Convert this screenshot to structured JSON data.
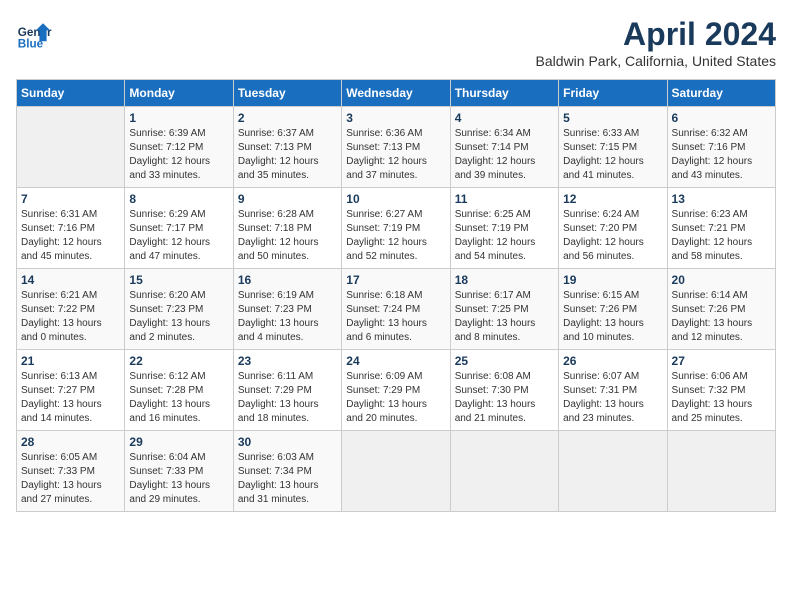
{
  "header": {
    "logo_line1": "General",
    "logo_line2": "Blue",
    "title": "April 2024",
    "location": "Baldwin Park, California, United States"
  },
  "days_of_week": [
    "Sunday",
    "Monday",
    "Tuesday",
    "Wednesday",
    "Thursday",
    "Friday",
    "Saturday"
  ],
  "weeks": [
    [
      {
        "day": "",
        "info": ""
      },
      {
        "day": "1",
        "info": "Sunrise: 6:39 AM\nSunset: 7:12 PM\nDaylight: 12 hours\nand 33 minutes."
      },
      {
        "day": "2",
        "info": "Sunrise: 6:37 AM\nSunset: 7:13 PM\nDaylight: 12 hours\nand 35 minutes."
      },
      {
        "day": "3",
        "info": "Sunrise: 6:36 AM\nSunset: 7:13 PM\nDaylight: 12 hours\nand 37 minutes."
      },
      {
        "day": "4",
        "info": "Sunrise: 6:34 AM\nSunset: 7:14 PM\nDaylight: 12 hours\nand 39 minutes."
      },
      {
        "day": "5",
        "info": "Sunrise: 6:33 AM\nSunset: 7:15 PM\nDaylight: 12 hours\nand 41 minutes."
      },
      {
        "day": "6",
        "info": "Sunrise: 6:32 AM\nSunset: 7:16 PM\nDaylight: 12 hours\nand 43 minutes."
      }
    ],
    [
      {
        "day": "7",
        "info": "Sunrise: 6:31 AM\nSunset: 7:16 PM\nDaylight: 12 hours\nand 45 minutes."
      },
      {
        "day": "8",
        "info": "Sunrise: 6:29 AM\nSunset: 7:17 PM\nDaylight: 12 hours\nand 47 minutes."
      },
      {
        "day": "9",
        "info": "Sunrise: 6:28 AM\nSunset: 7:18 PM\nDaylight: 12 hours\nand 50 minutes."
      },
      {
        "day": "10",
        "info": "Sunrise: 6:27 AM\nSunset: 7:19 PM\nDaylight: 12 hours\nand 52 minutes."
      },
      {
        "day": "11",
        "info": "Sunrise: 6:25 AM\nSunset: 7:19 PM\nDaylight: 12 hours\nand 54 minutes."
      },
      {
        "day": "12",
        "info": "Sunrise: 6:24 AM\nSunset: 7:20 PM\nDaylight: 12 hours\nand 56 minutes."
      },
      {
        "day": "13",
        "info": "Sunrise: 6:23 AM\nSunset: 7:21 PM\nDaylight: 12 hours\nand 58 minutes."
      }
    ],
    [
      {
        "day": "14",
        "info": "Sunrise: 6:21 AM\nSunset: 7:22 PM\nDaylight: 13 hours\nand 0 minutes."
      },
      {
        "day": "15",
        "info": "Sunrise: 6:20 AM\nSunset: 7:23 PM\nDaylight: 13 hours\nand 2 minutes."
      },
      {
        "day": "16",
        "info": "Sunrise: 6:19 AM\nSunset: 7:23 PM\nDaylight: 13 hours\nand 4 minutes."
      },
      {
        "day": "17",
        "info": "Sunrise: 6:18 AM\nSunset: 7:24 PM\nDaylight: 13 hours\nand 6 minutes."
      },
      {
        "day": "18",
        "info": "Sunrise: 6:17 AM\nSunset: 7:25 PM\nDaylight: 13 hours\nand 8 minutes."
      },
      {
        "day": "19",
        "info": "Sunrise: 6:15 AM\nSunset: 7:26 PM\nDaylight: 13 hours\nand 10 minutes."
      },
      {
        "day": "20",
        "info": "Sunrise: 6:14 AM\nSunset: 7:26 PM\nDaylight: 13 hours\nand 12 minutes."
      }
    ],
    [
      {
        "day": "21",
        "info": "Sunrise: 6:13 AM\nSunset: 7:27 PM\nDaylight: 13 hours\nand 14 minutes."
      },
      {
        "day": "22",
        "info": "Sunrise: 6:12 AM\nSunset: 7:28 PM\nDaylight: 13 hours\nand 16 minutes."
      },
      {
        "day": "23",
        "info": "Sunrise: 6:11 AM\nSunset: 7:29 PM\nDaylight: 13 hours\nand 18 minutes."
      },
      {
        "day": "24",
        "info": "Sunrise: 6:09 AM\nSunset: 7:29 PM\nDaylight: 13 hours\nand 20 minutes."
      },
      {
        "day": "25",
        "info": "Sunrise: 6:08 AM\nSunset: 7:30 PM\nDaylight: 13 hours\nand 21 minutes."
      },
      {
        "day": "26",
        "info": "Sunrise: 6:07 AM\nSunset: 7:31 PM\nDaylight: 13 hours\nand 23 minutes."
      },
      {
        "day": "27",
        "info": "Sunrise: 6:06 AM\nSunset: 7:32 PM\nDaylight: 13 hours\nand 25 minutes."
      }
    ],
    [
      {
        "day": "28",
        "info": "Sunrise: 6:05 AM\nSunset: 7:33 PM\nDaylight: 13 hours\nand 27 minutes."
      },
      {
        "day": "29",
        "info": "Sunrise: 6:04 AM\nSunset: 7:33 PM\nDaylight: 13 hours\nand 29 minutes."
      },
      {
        "day": "30",
        "info": "Sunrise: 6:03 AM\nSunset: 7:34 PM\nDaylight: 13 hours\nand 31 minutes."
      },
      {
        "day": "",
        "info": ""
      },
      {
        "day": "",
        "info": ""
      },
      {
        "day": "",
        "info": ""
      },
      {
        "day": "",
        "info": ""
      }
    ]
  ]
}
